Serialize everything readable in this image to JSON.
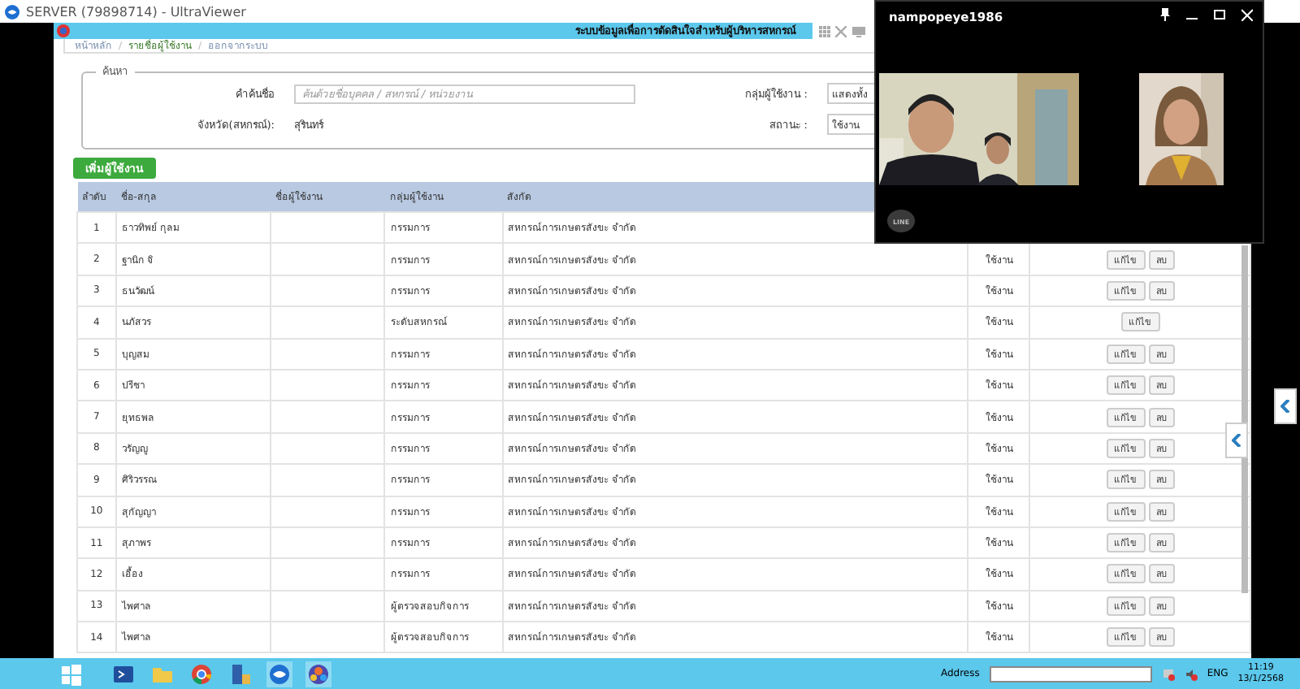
{
  "app_window": {
    "title": "SERVER (79898714) - UltraViewer"
  },
  "remote_page": {
    "header_title": "ระบบข้อมูลเพื่อการตัดสินใจสำหรับผู้บริหารสหกรณ์",
    "breadcrumb_separator": "/",
    "breadcrumb": [
      {
        "label": "หน้าหลัก",
        "selected": false
      },
      {
        "label": "รายชื่อผู้ใช้งาน",
        "selected": true
      },
      {
        "label": "ออกจากระบบ",
        "selected": false
      }
    ],
    "search": {
      "legend": "ค้นหา",
      "keyword_label": "คำค้นชื่อ",
      "keyword_placeholder": "ค้นด้วยชื่อบุคคล / สหกรณ์ / หน่วยงาน",
      "province_label": "จังหวัด(สหกรณ์):",
      "province_value": "สุรินทร์",
      "group_label": "กลุ่มผู้ใช้งาน :",
      "group_value": "แสดงทั้ง",
      "status_label": "สถานะ :",
      "status_value": "ใช้งาน"
    },
    "add_button": "เพิ่มผู้ใช้งาน",
    "table": {
      "columns": [
        "ลำดับ",
        "ชื่อ-สกุล",
        "ชื่อผู้ใช้งาน",
        "กลุ่มผู้ใช้งาน",
        "สังกัด"
      ],
      "rows": [
        {
          "no": "1",
          "name": "ธาวทิพย์ กุลม",
          "group": "กรรมการ",
          "affiliation": "สหกรณ์การเกษตรสังขะ จำกัด"
        },
        {
          "no": "2",
          "name": "ฐานิก จิ",
          "group": "กรรมการ",
          "affiliation": "สหกรณ์การเกษตรสังขะ จำกัด",
          "status": "ใช้งาน",
          "actions": [
            "แก้ไข",
            "ลบ"
          ]
        },
        {
          "no": "3",
          "name": "ธนวัฒน์",
          "group": "กรรมการ",
          "affiliation": "สหกรณ์การเกษตรสังขะ จำกัด",
          "status": "ใช้งาน",
          "actions": [
            "แก้ไข",
            "ลบ"
          ]
        },
        {
          "no": "4",
          "name": "นภัสวร",
          "group": "ระดับสหกรณ์",
          "affiliation": "สหกรณ์การเกษตรสังขะ จำกัด",
          "status": "ใช้งาน",
          "actions": [
            "แก้ไข"
          ]
        },
        {
          "no": "5",
          "name": "บุญสม",
          "group": "กรรมการ",
          "affiliation": "สหกรณ์การเกษตรสังขะ จำกัด",
          "status": "ใช้งาน",
          "actions": [
            "แก้ไข",
            "ลบ"
          ]
        },
        {
          "no": "6",
          "name": "ปรีชา",
          "group": "กรรมการ",
          "affiliation": "สหกรณ์การเกษตรสังขะ จำกัด",
          "status": "ใช้งาน",
          "actions": [
            "แก้ไข",
            "ลบ"
          ]
        },
        {
          "no": "7",
          "name": "ยุทธพล",
          "group": "กรรมการ",
          "affiliation": "สหกรณ์การเกษตรสังขะ จำกัด",
          "status": "ใช้งาน",
          "actions": [
            "แก้ไข",
            "ลบ"
          ]
        },
        {
          "no": "8",
          "name": "วรัญญู",
          "group": "กรรมการ",
          "affiliation": "สหกรณ์การเกษตรสังขะ จำกัด",
          "status": "ใช้งาน",
          "actions": [
            "แก้ไข",
            "ลบ"
          ]
        },
        {
          "no": "9",
          "name": "ศิริวรรณ",
          "group": "กรรมการ",
          "affiliation": "สหกรณ์การเกษตรสังขะ จำกัด",
          "status": "ใช้งาน",
          "actions": [
            "แก้ไข",
            "ลบ"
          ]
        },
        {
          "no": "10",
          "name": "สุกัญญา",
          "group": "กรรมการ",
          "affiliation": "สหกรณ์การเกษตรสังขะ จำกัด",
          "status": "ใช้งาน",
          "actions": [
            "แก้ไข",
            "ลบ"
          ]
        },
        {
          "no": "11",
          "name": "สุภาพร",
          "group": "กรรมการ",
          "affiliation": "สหกรณ์การเกษตรสังขะ จำกัด",
          "status": "ใช้งาน",
          "actions": [
            "แก้ไข",
            "ลบ"
          ]
        },
        {
          "no": "12",
          "name": "เอื้อง",
          "group": "กรรมการ",
          "affiliation": "สหกรณ์การเกษตรสังขะ จำกัด",
          "status": "ใช้งาน",
          "actions": [
            "แก้ไข",
            "ลบ"
          ]
        },
        {
          "no": "13",
          "name": "ไพศาล",
          "group": "ผู้ตรวจสอบกิจการ",
          "affiliation": "สหกรณ์การเกษตรสังขะ จำกัด",
          "status": "ใช้งาน",
          "actions": [
            "แก้ไข",
            "ลบ"
          ]
        },
        {
          "no": "14",
          "name": "ไพศาล",
          "group": "ผู้ตรวจสอบกิจการ",
          "affiliation": "สหกรณ์การเกษตรสังขะ จำกัด",
          "status": "ใช้งาน",
          "actions": [
            "แก้ไข",
            "ลบ"
          ]
        }
      ]
    }
  },
  "video_call": {
    "title": "nampopeye1986",
    "logo_text": "LINE"
  },
  "taskbar": {
    "address_label": "Address",
    "language": "ENG",
    "time": "11:19",
    "date": "13/1/2568"
  }
}
